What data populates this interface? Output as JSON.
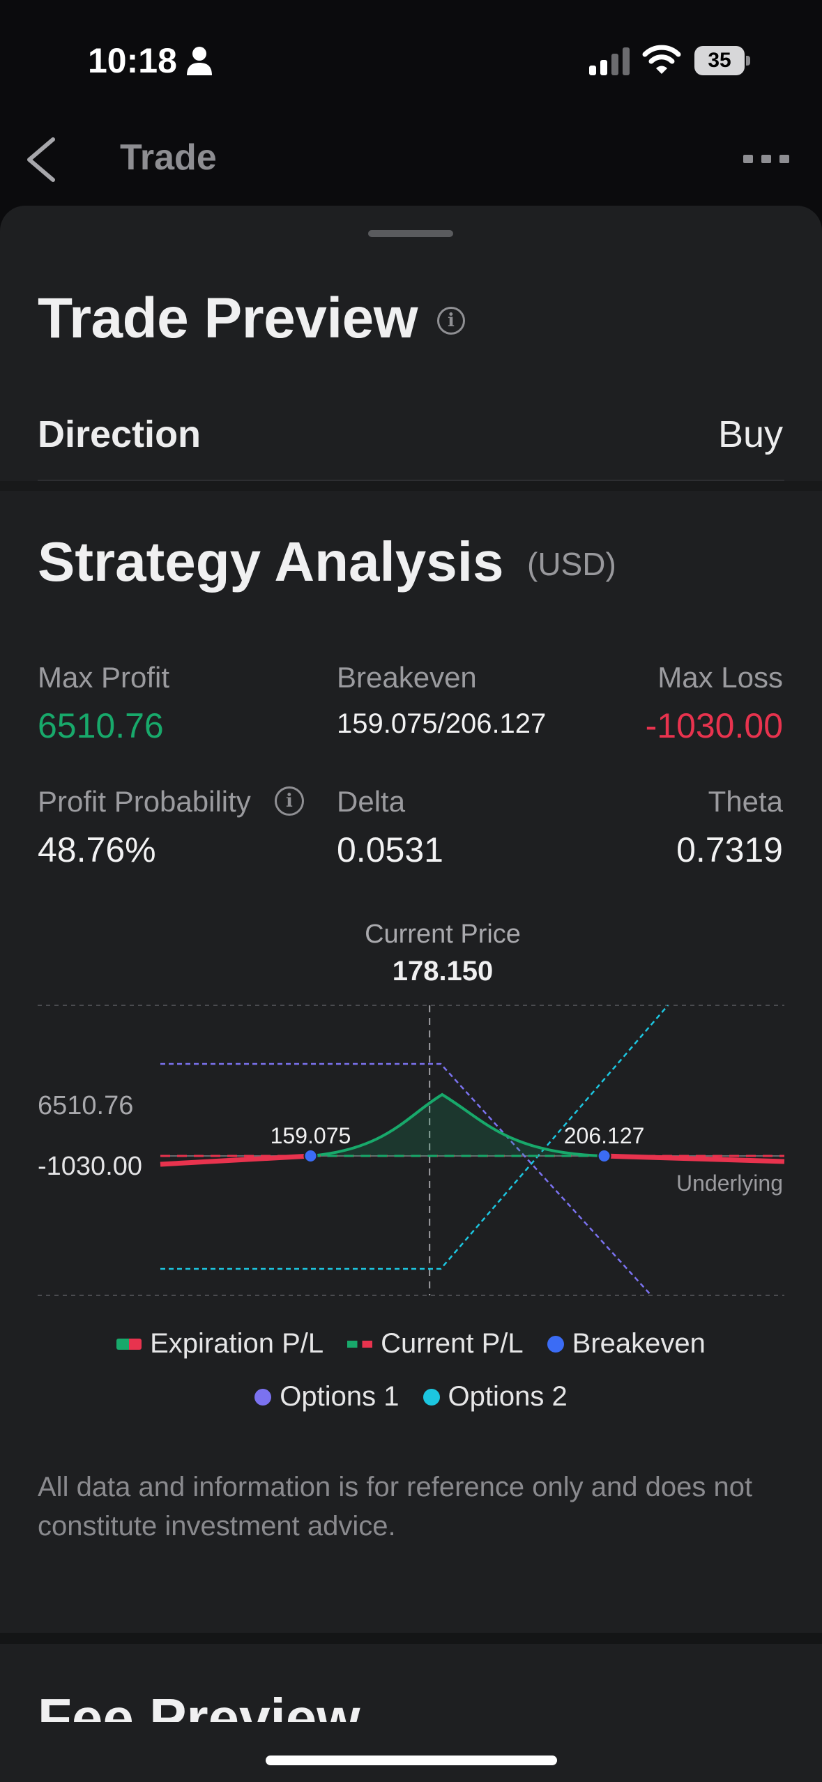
{
  "status_bar": {
    "time": "10:18",
    "battery": "35"
  },
  "nav": {
    "title": "Trade"
  },
  "trade_preview": {
    "title": "Trade Preview",
    "direction_label": "Direction",
    "direction_value": "Buy"
  },
  "strategy": {
    "title": "Strategy Analysis",
    "unit": "(USD)",
    "stats": {
      "max_profit_label": "Max Profit",
      "max_profit_value": "6510.76",
      "breakeven_label": "Breakeven",
      "breakeven_value": "159.075/206.127",
      "max_loss_label": "Max Loss",
      "max_loss_value": "-1030.00",
      "profit_prob_label": "Profit Probability",
      "profit_prob_value": "48.76%",
      "delta_label": "Delta",
      "delta_value": "0.0531",
      "theta_label": "Theta",
      "theta_value": "0.7319"
    }
  },
  "colors": {
    "profit": "#18a96b",
    "loss": "#e8334e",
    "breakeven": "#3b6cf5",
    "options1": "#7b72f0",
    "options2": "#1cc6e0"
  },
  "chart_data": {
    "type": "line",
    "title": "",
    "current_price_label": "Current Price",
    "current_price": 178.15,
    "current_price_text": "178.150",
    "xlabel": "Underlying",
    "y_tick_labels": [
      "6510.76",
      "-1030.00"
    ],
    "breakevens": [
      159.075,
      206.127
    ],
    "breakeven_labels": [
      "159.075",
      "206.127"
    ],
    "x_range": [
      135,
      235
    ],
    "series": [
      {
        "name": "Expiration P/L",
        "x": [
          135,
          159.075,
          178.15,
          206.127,
          235
        ],
        "y": [
          -1030,
          0,
          6510.76,
          0,
          -1030
        ]
      },
      {
        "name": "Current P/L",
        "x": [
          135,
          235
        ],
        "y": [
          0,
          0
        ]
      },
      {
        "name": "Options 1",
        "x": [
          135,
          178.15,
          235
        ],
        "y": [
          1,
          1,
          -1
        ]
      },
      {
        "name": "Options 2",
        "x": [
          135,
          178.15,
          235
        ],
        "y": [
          -1,
          -1,
          1
        ]
      }
    ]
  },
  "legend": {
    "expiration": "Expiration P/L",
    "current": "Current P/L",
    "breakeven": "Breakeven",
    "options1": "Options 1",
    "options2": "Options 2"
  },
  "disclaimer": "All data and information is for reference only and does not constitute investment advice.",
  "fee_preview": {
    "title": "Fee Preview"
  }
}
